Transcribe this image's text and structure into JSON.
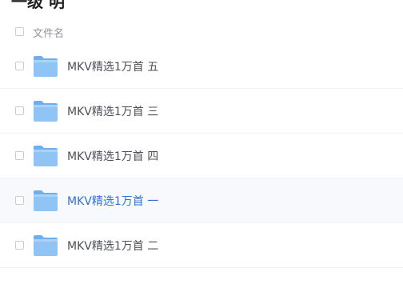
{
  "title_fragment": "一级 明",
  "header": {
    "name_label": "文件名"
  },
  "files": [
    {
      "name": "MKV精选1万首 五",
      "icon": "folder-icon",
      "hover": false
    },
    {
      "name": "MKV精选1万首 三",
      "icon": "folder-icon",
      "hover": false
    },
    {
      "name": "MKV精选1万首 四",
      "icon": "folder-icon",
      "hover": false
    },
    {
      "name": "MKV精选1万首 一",
      "icon": "folder-icon",
      "hover": true
    },
    {
      "name": "MKV精选1万首 二",
      "icon": "folder-icon",
      "hover": false
    }
  ],
  "colors": {
    "folder": "#8fc4f5",
    "folder_tab": "#6eb0ef",
    "link": "#3370d4",
    "text": "#4d5157"
  }
}
